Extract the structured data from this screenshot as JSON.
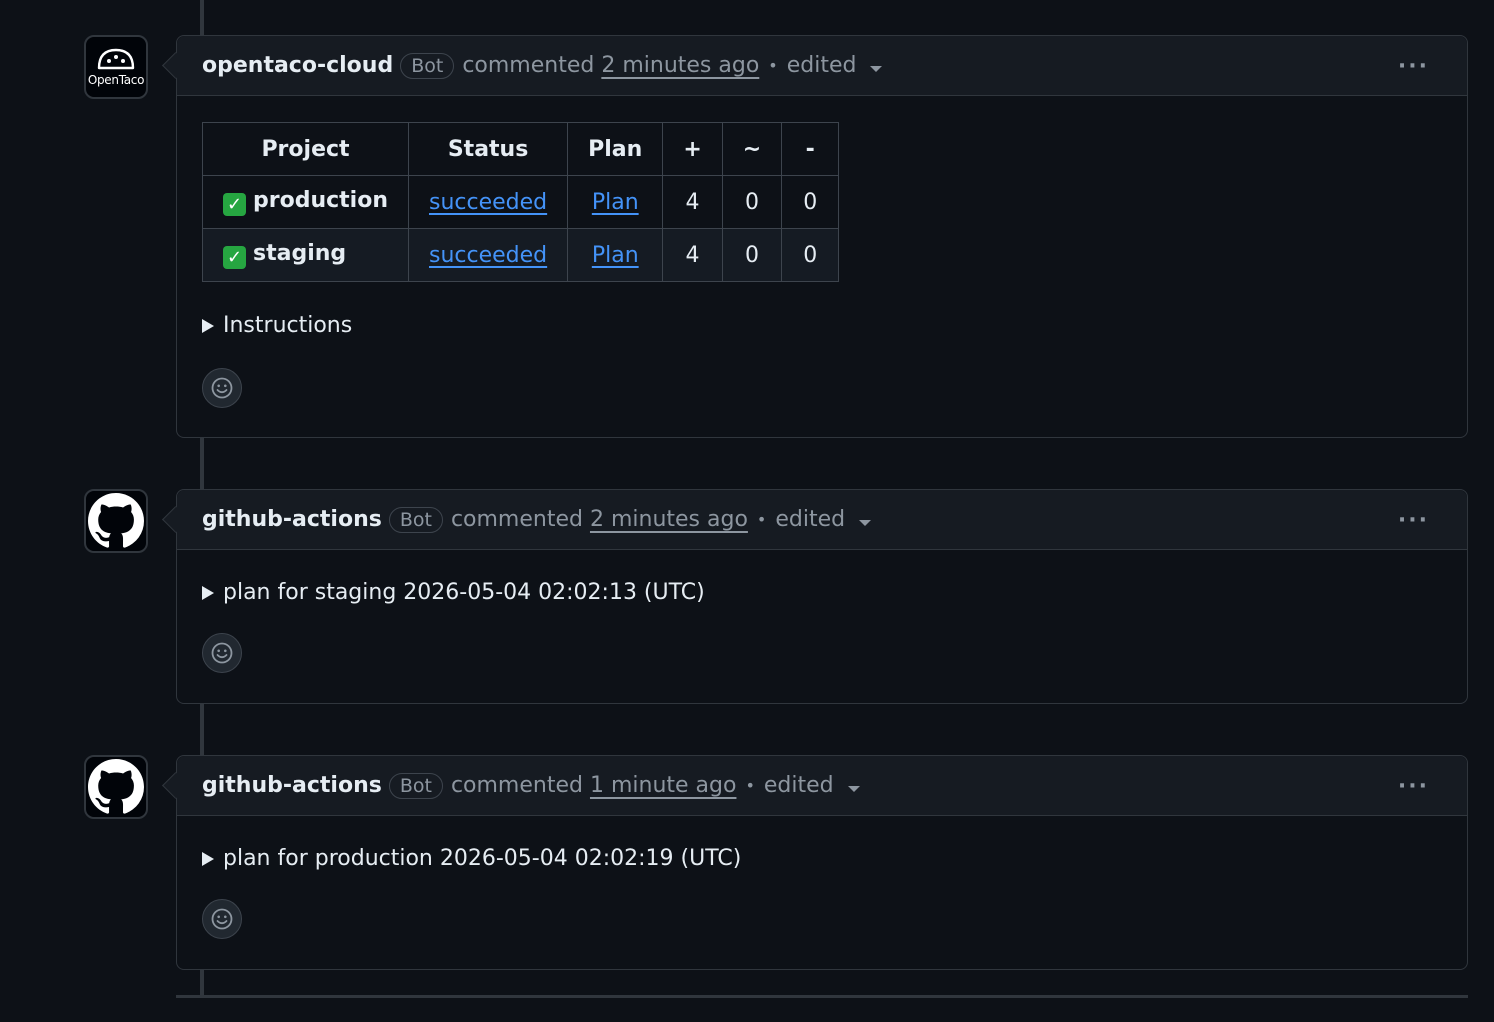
{
  "comments": [
    {
      "author": "opentaco-cloud",
      "bot_label": "Bot",
      "action": "commented",
      "time": "2 minutes ago",
      "separator": "•",
      "edited": "edited",
      "more": "···",
      "avatar_text": "OpenTaco",
      "table": {
        "headers": [
          "Project",
          "Status",
          "Plan",
          "+",
          "~",
          "-"
        ],
        "rows": [
          {
            "project": "production",
            "status": "succeeded",
            "plan": "Plan",
            "add": "4",
            "change": "0",
            "destroy": "0"
          },
          {
            "project": "staging",
            "status": "succeeded",
            "plan": "Plan",
            "add": "4",
            "change": "0",
            "destroy": "0"
          }
        ]
      },
      "details_summary": "Instructions"
    },
    {
      "author": "github-actions",
      "bot_label": "Bot",
      "action": "commented",
      "time": "2 minutes ago",
      "separator": "•",
      "edited": "edited",
      "more": "···",
      "details_summary": "plan for staging 2026-05-04 02:02:13 (UTC)"
    },
    {
      "author": "github-actions",
      "bot_label": "Bot",
      "action": "commented",
      "time": "1 minute ago",
      "separator": "•",
      "edited": "edited",
      "more": "···",
      "details_summary": "plan for production 2026-05-04 02:02:19 (UTC)"
    }
  ],
  "icons": {
    "check": "white-heavy-check-mark-icon",
    "reaction": "smiley-icon",
    "github": "github-mark-icon",
    "opentaco": "opentaco-logo-icon"
  },
  "colors": {
    "background": "#0d1117",
    "header": "#161b22",
    "border": "#30363d",
    "link": "#4493f8",
    "check": "#26a641",
    "muted": "#8d96a0"
  }
}
